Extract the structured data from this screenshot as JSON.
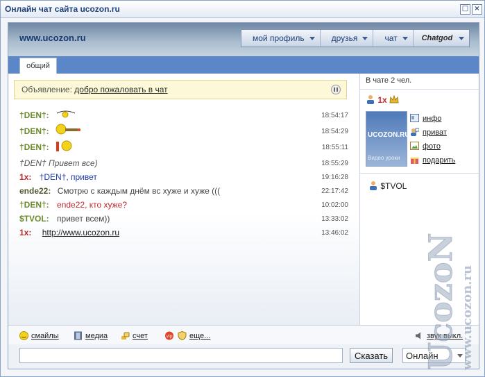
{
  "window": {
    "title": "Онлайн чат сайта ucozon.ru"
  },
  "header": {
    "site_name": "www.ucozon.ru",
    "nav": [
      "мой профиль",
      "друзья",
      "чат",
      "Chatgod"
    ]
  },
  "tabs": [
    "общий"
  ],
  "announcement": {
    "label": "Объявление:",
    "text": "добро пожаловать в чат"
  },
  "messages": [
    {
      "nick": "†DEN†:",
      "text": "",
      "time": "18:54:17"
    },
    {
      "nick": "†DEN†:",
      "text": "",
      "time": "18:54:29"
    },
    {
      "nick": "†DEN†:",
      "text": "",
      "time": "18:55:11"
    },
    {
      "nick": "",
      "text": "†DEN† Привет все)",
      "time": "18:55:29"
    },
    {
      "nick": "1x:",
      "to": "†DEN†",
      "text": ", привет",
      "time": "19:16:28"
    },
    {
      "nick": "ende22:",
      "text": "Смотрю с каждым днём вс хуже и хуже (((",
      "time": "22:17:42"
    },
    {
      "nick": "†DEN†:",
      "text": "ende22, кто хуже?",
      "time": "10:02:00"
    },
    {
      "nick": "$TVOL:",
      "text": "привет всем))",
      "time": "13:33:02"
    },
    {
      "nick": "1x:",
      "text": "http://www.ucozon.ru",
      "time": "13:46:02"
    }
  ],
  "sidebar": {
    "count_text": "В чате 2 чел.",
    "selected_user": "1x",
    "thumb_title": "UCOZON.RU",
    "thumb_caption": "Видео уроки",
    "actions": [
      "инфо",
      "приват",
      "фото",
      "подарить"
    ],
    "users": [
      "$TVOL"
    ]
  },
  "toolbar": {
    "smiles": "смайлы",
    "media": "медиа",
    "score": "счет",
    "more": "еще...",
    "sound": "звук выкл."
  },
  "input": {
    "value": "",
    "send_label": "Сказать",
    "status": "Онлайн"
  },
  "watermark": {
    "text1": "UcozoN",
    "text2": "www.ucozon.ru"
  },
  "colors": {
    "accent": "#5b87c9",
    "nick_green": "#6b8a2a",
    "nick_red": "#c1272d",
    "link_blue": "#1d3aa8"
  }
}
